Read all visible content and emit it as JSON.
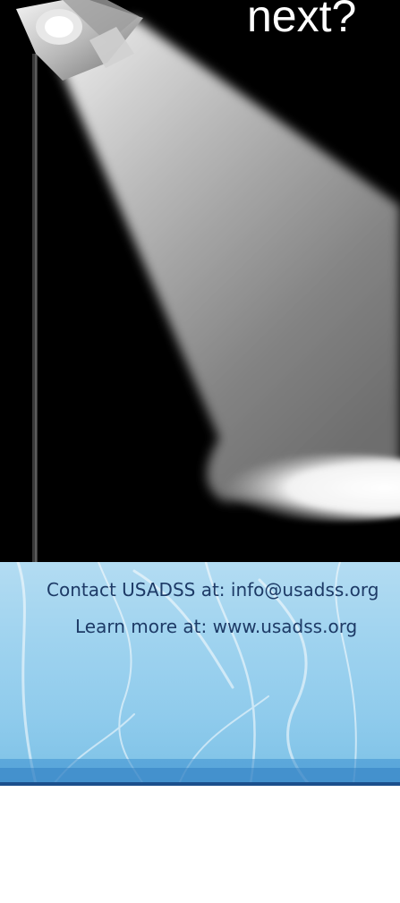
{
  "slide": {
    "headline": "next?",
    "contact_line": "Contact USADSS at: info@usadss.org",
    "learn_line": "Learn more at: www.usadss.org"
  },
  "colors": {
    "stage_background": "#000000",
    "headline_text": "#ffffff",
    "footer_text": "#1d3a66",
    "footer_rule": "#1b4f8c",
    "footer_light_blue": "#9fd3ef"
  },
  "icons": {
    "spotlight": "spotlight-lamp-icon",
    "light_beam": "light-beam-icon",
    "light_pool": "light-pool-icon"
  }
}
